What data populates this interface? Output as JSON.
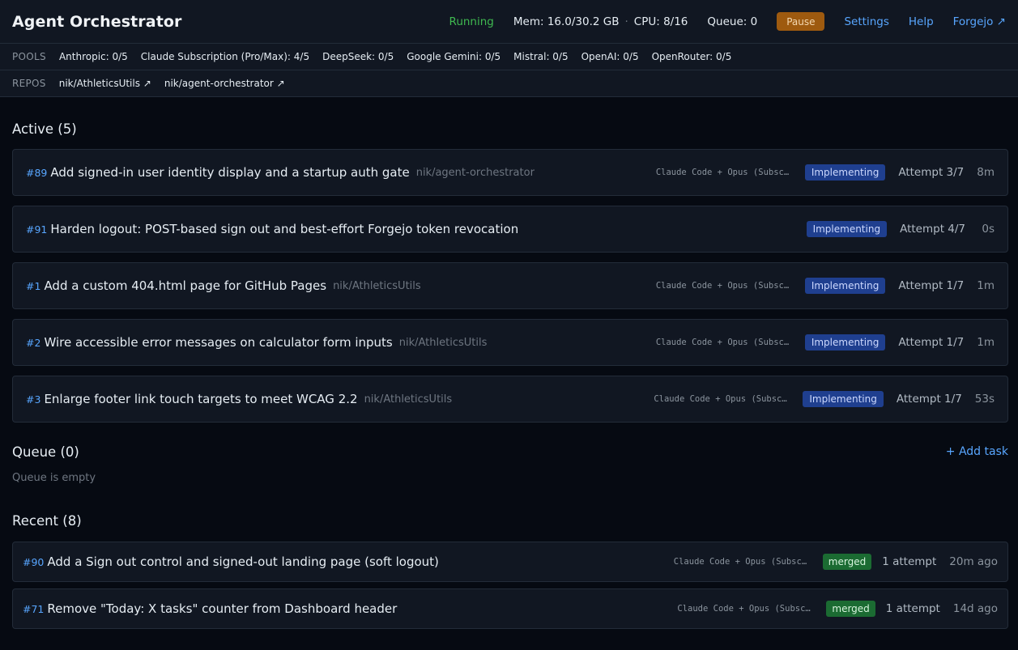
{
  "header": {
    "title": "Agent Orchestrator",
    "status": "Running",
    "mem": "Mem: 16.0/30.2 GB",
    "separator": "·",
    "cpu": "CPU: 8/16",
    "queue": "Queue: 0",
    "pause_label": "Pause",
    "settings_label": "Settings",
    "help_label": "Help",
    "forgejo_label": "Forgejo ↗",
    "status_color": "#3fb950",
    "accent_color": "#58a6ff"
  },
  "pools": {
    "label": "POOLS",
    "items": [
      "Anthropic: 0/5",
      "Claude Subscription (Pro/Max): 4/5",
      "DeepSeek: 0/5",
      "Google Gemini: 0/5",
      "Mistral: 0/5",
      "OpenAI: 0/5",
      "OpenRouter: 0/5"
    ]
  },
  "repos": {
    "label": "REPOS",
    "items": [
      "nik/AthleticsUtils ↗",
      "nik/agent-orchestrator ↗"
    ]
  },
  "active": {
    "heading": "Active (5)",
    "tasks": [
      {
        "num": "#89",
        "title": "Add signed-in user identity display and a startup auth gate",
        "repo": "nik/agent-orchestrator",
        "agent": "Claude Code + Opus (Subscription)",
        "status": "Implementing",
        "attempt": "Attempt 3/7",
        "elapsed": "8m"
      },
      {
        "num": "#91",
        "title": "Harden logout: POST-based sign out and best-effort Forgejo token revocation",
        "repo": "",
        "agent": "",
        "status": "Implementing",
        "attempt": "Attempt 4/7",
        "elapsed": "0s"
      },
      {
        "num": "#1",
        "title": "Add a custom 404.html page for GitHub Pages",
        "repo": "nik/AthleticsUtils",
        "agent": "Claude Code + Opus (Subscription)",
        "status": "Implementing",
        "attempt": "Attempt 1/7",
        "elapsed": "1m"
      },
      {
        "num": "#2",
        "title": "Wire accessible error messages on calculator form inputs",
        "repo": "nik/AthleticsUtils",
        "agent": "Claude Code + Opus (Subscription)",
        "status": "Implementing",
        "attempt": "Attempt 1/7",
        "elapsed": "1m"
      },
      {
        "num": "#3",
        "title": "Enlarge footer link touch targets to meet WCAG 2.2",
        "repo": "nik/AthleticsUtils",
        "agent": "Claude Code + Opus (Subscription)",
        "status": "Implementing",
        "attempt": "Attempt 1/7",
        "elapsed": "53s"
      }
    ]
  },
  "queue": {
    "heading": "Queue (0)",
    "add_task_label": "+ Add task",
    "empty_text": "Queue is empty"
  },
  "recent": {
    "heading": "Recent (8)",
    "tasks": [
      {
        "num": "#90",
        "title": "Add a Sign out control and signed-out landing page (soft logout)",
        "agent": "Claude Code + Opus (Subscription)",
        "status": "merged",
        "attempt": "1 attempt",
        "elapsed": "20m ago"
      },
      {
        "num": "#71",
        "title": "Remove \"Today: X tasks\" counter from Dashboard header",
        "agent": "Claude Code + Opus (Subscription)",
        "status": "merged",
        "attempt": "1 attempt",
        "elapsed": "14d ago"
      }
    ]
  }
}
